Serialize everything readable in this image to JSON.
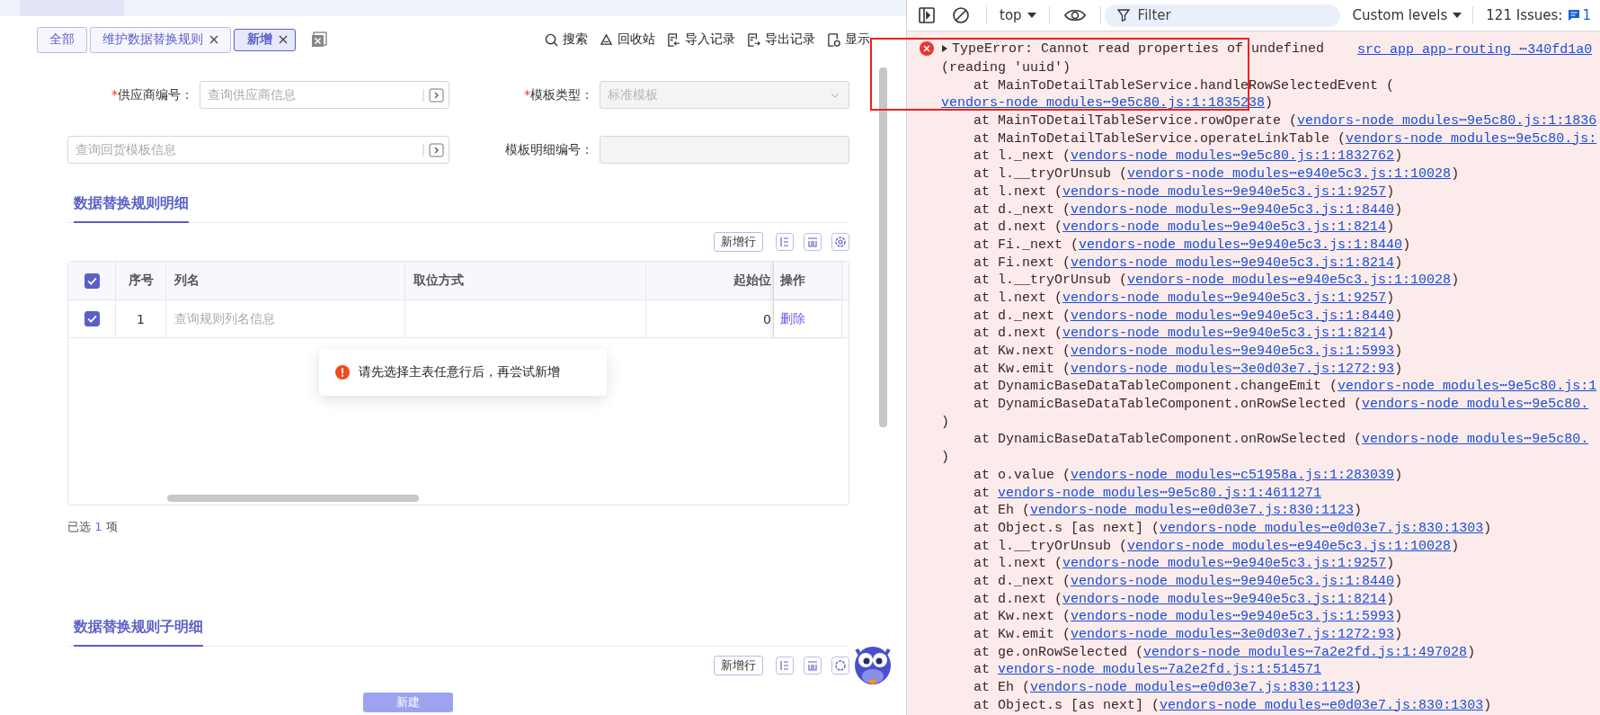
{
  "page_tabs": [
    {
      "label": "全部",
      "closable": false,
      "selected": false
    },
    {
      "label": "维护数据替换规则",
      "closable": true,
      "selected": false
    },
    {
      "label": "新增",
      "closable": true,
      "selected": true
    }
  ],
  "actions": [
    {
      "kind": "search",
      "label": "搜索"
    },
    {
      "kind": "recycle",
      "label": "回收站"
    },
    {
      "kind": "import",
      "label": "导入记录"
    },
    {
      "kind": "export",
      "label": "导出记录"
    },
    {
      "kind": "display",
      "label": "显示"
    }
  ],
  "form": {
    "fields": [
      {
        "kind": "lookup",
        "required_mark": "*",
        "label": "供应商编号：",
        "placeholder": "查询供应商信息",
        "disabled": false
      },
      {
        "kind": "select",
        "required_mark": "*",
        "label": "模板类型：",
        "value": "标准模板",
        "disabled": true
      },
      {
        "kind": "lookup",
        "placeholder": "查询回货模板信息",
        "disabled": false
      },
      {
        "kind": "text",
        "label": "模板明细编号：",
        "disabled": true
      }
    ]
  },
  "sections": [
    {
      "title": "数据替换规则明细",
      "add_row": "新增行",
      "table": {
        "header_checked": true,
        "columns": [
          {
            "label": "序号"
          },
          {
            "label": "列名"
          },
          {
            "label": "取位方式"
          },
          {
            "label": "起始位"
          },
          {
            "label": "操作"
          }
        ],
        "rows": [
          {
            "checked": true,
            "index": "1",
            "column_name_placeholder": "查询规则列名信息",
            "start": "0",
            "action": "删除"
          }
        ]
      },
      "selection": {
        "prefix": "已选",
        "count": "1",
        "suffix": "项"
      }
    },
    {
      "title": "数据替换规则子明细",
      "add_row": "新增行"
    }
  ],
  "toast": {
    "kind": "error",
    "message": "请先选择主表任意行后，再尝试新增"
  },
  "footer_button": {
    "label": "新建",
    "disabled": true
  },
  "console": {
    "context": "top",
    "filter_placeholder": "Filter",
    "levels": "Custom levels",
    "issues": "121 Issues:",
    "issues_count": "1",
    "error": {
      "message": "TypeError: Cannot read properties of undefined",
      "source": "src_app_app-routing_⋯340fd1a0",
      "lines": [
        {
          "kind": "cont",
          "text": "(reading 'uuid')"
        },
        {
          "kind": "frame",
          "text": "at MainToDetailTableService.handleRowSelectedEvent ("
        },
        {
          "kind": "cont",
          "link": "vendors-node_modules⋯9e5c80.js:1:1835238",
          "tail": ")"
        },
        {
          "kind": "frame",
          "text": "at MainToDetailTableService.rowOperate (",
          "link": "vendors-node_modules⋯9e5c80.js:1:1836"
        },
        {
          "kind": "frame",
          "text": "at MainToDetailTableService.operateLinkTable (",
          "link": "vendors-node_modules⋯9e5c80.js:"
        },
        {
          "kind": "frame",
          "text": "at l._next (",
          "link": "vendors-node_modules⋯9e5c80.js:1:1832762",
          "tail": ")"
        },
        {
          "kind": "frame",
          "text": "at l.__tryOrUnsub (",
          "link": "vendors-node_modules⋯e940e5c3.js:1:10028",
          "tail": ")"
        },
        {
          "kind": "frame",
          "text": "at l.next (",
          "link": "vendors-node_modules⋯9e940e5c3.js:1:9257",
          "tail": ")"
        },
        {
          "kind": "frame",
          "text": "at d._next (",
          "link": "vendors-node_modules⋯9e940e5c3.js:1:8440",
          "tail": ")"
        },
        {
          "kind": "frame",
          "text": "at d.next (",
          "link": "vendors-node_modules⋯9e940e5c3.js:1:8214",
          "tail": ")"
        },
        {
          "kind": "frame",
          "text": "at Fi._next (",
          "link": "vendors-node_modules⋯9e940e5c3.js:1:8440",
          "tail": ")"
        },
        {
          "kind": "frame",
          "text": "at Fi.next (",
          "link": "vendors-node_modules⋯9e940e5c3.js:1:8214",
          "tail": ")"
        },
        {
          "kind": "frame",
          "text": "at l.__tryOrUnsub (",
          "link": "vendors-node_modules⋯e940e5c3.js:1:10028",
          "tail": ")"
        },
        {
          "kind": "frame",
          "text": "at l.next (",
          "link": "vendors-node_modules⋯9e940e5c3.js:1:9257",
          "tail": ")"
        },
        {
          "kind": "frame",
          "text": "at d._next (",
          "link": "vendors-node_modules⋯9e940e5c3.js:1:8440",
          "tail": ")"
        },
        {
          "kind": "frame",
          "text": "at d.next (",
          "link": "vendors-node_modules⋯9e940e5c3.js:1:8214",
          "tail": ")"
        },
        {
          "kind": "frame",
          "text": "at Kw.next (",
          "link": "vendors-node_modules⋯9e940e5c3.js:1:5993",
          "tail": ")"
        },
        {
          "kind": "frame",
          "text": "at Kw.emit (",
          "link": "vendors-node_modules⋯3e0d03e7.js:1272:93",
          "tail": ")"
        },
        {
          "kind": "frame",
          "text": "at DynamicBaseDataTableComponent.changeEmit (",
          "link": "vendors-node_modules⋯9e5c80.js:1"
        },
        {
          "kind": "frame",
          "text": "at DynamicBaseDataTableComponent.onRowSelected (",
          "link": "vendors-node_modules⋯9e5c80."
        },
        {
          "kind": "cont",
          "text": ")"
        },
        {
          "kind": "frame",
          "text": "at DynamicBaseDataTableComponent.onRowSelected (",
          "link": "vendors-node_modules⋯9e5c80."
        },
        {
          "kind": "cont",
          "text": ")"
        },
        {
          "kind": "frame",
          "text": "at o.value (",
          "link": "vendors-node_modules⋯c51958a.js:1:283039",
          "tail": ")"
        },
        {
          "kind": "frame",
          "text": "at ",
          "link": "vendors-node_modules⋯9e5c80.js:1:4611271"
        },
        {
          "kind": "frame",
          "text": "at Eh (",
          "link": "vendors-node_modules⋯e0d03e7.js:830:1123",
          "tail": ")"
        },
        {
          "kind": "frame",
          "text": "at Object.s [as next] (",
          "link": "vendors-node_modules⋯e0d03e7.js:830:1303",
          "tail": ")"
        },
        {
          "kind": "frame",
          "text": "at l.__tryOrUnsub (",
          "link": "vendors-node_modules⋯e940e5c3.js:1:10028",
          "tail": ")"
        },
        {
          "kind": "frame",
          "text": "at l.next (",
          "link": "vendors-node_modules⋯9e940e5c3.js:1:9257",
          "tail": ")"
        },
        {
          "kind": "frame",
          "text": "at d._next (",
          "link": "vendors-node_modules⋯9e940e5c3.js:1:8440",
          "tail": ")"
        },
        {
          "kind": "frame",
          "text": "at d.next (",
          "link": "vendors-node_modules⋯9e940e5c3.js:1:8214",
          "tail": ")"
        },
        {
          "kind": "frame",
          "text": "at Kw.next (",
          "link": "vendors-node_modules⋯9e940e5c3.js:1:5993",
          "tail": ")"
        },
        {
          "kind": "frame",
          "text": "at Kw.emit (",
          "link": "vendors-node_modules⋯3e0d03e7.js:1272:93",
          "tail": ")"
        },
        {
          "kind": "frame",
          "text": "at ge.onRowSelected (",
          "link": "vendors-node_modules⋯7a2e2fd.js:1:497028",
          "tail": ")"
        },
        {
          "kind": "frame",
          "text": "at ",
          "link": "vendors-node_modules⋯7a2e2fd.js:1:514571"
        },
        {
          "kind": "frame",
          "text": "at Eh (",
          "link": "vendors-node_modules⋯e0d03e7.js:830:1123",
          "tail": ")"
        },
        {
          "kind": "frame",
          "text": "at Object.s [as next] (",
          "link": "vendors-node_modules⋯e0d03e7.js:830:1303",
          "tail": ")"
        }
      ]
    }
  }
}
